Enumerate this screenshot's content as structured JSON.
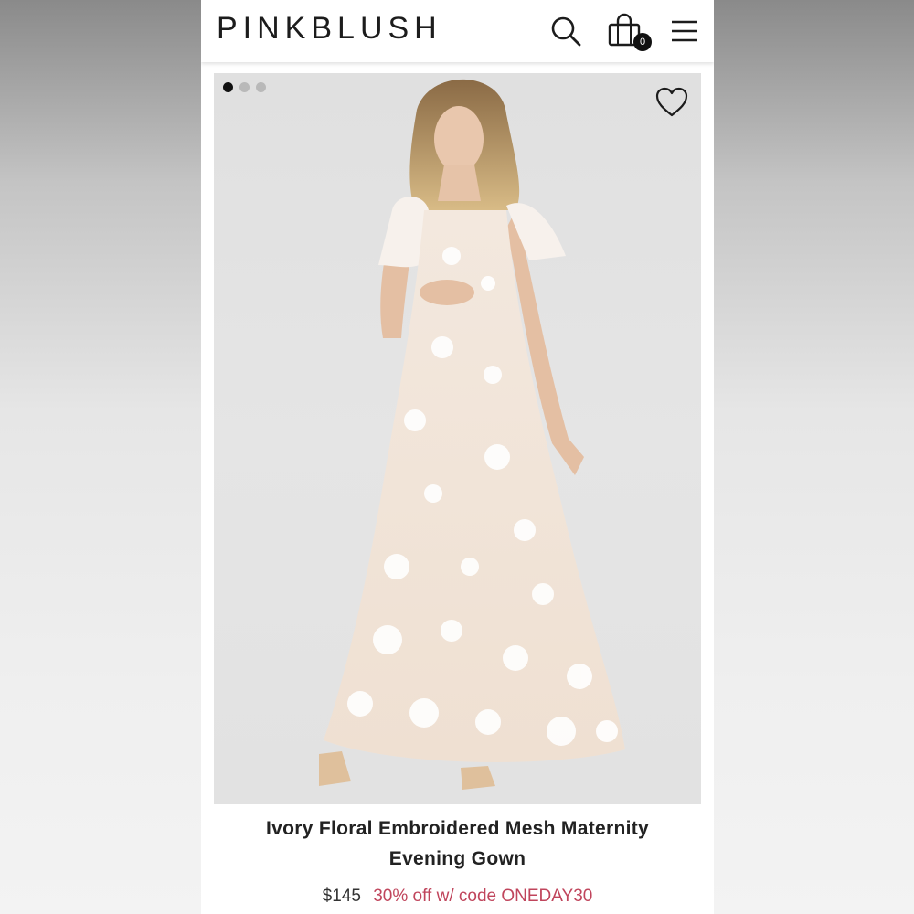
{
  "header": {
    "logo": "PINKBLUSH",
    "cart_count": "0",
    "icons": [
      "search-icon",
      "shopping-bag-icon",
      "menu-icon"
    ]
  },
  "gallery": {
    "image_count": 3,
    "active_index": 0
  },
  "product": {
    "title_line1": "Ivory Floral Embroidered Mesh Maternity",
    "title_line2": "Evening Gown",
    "price": "$145",
    "promo": "30% off w/ code ONEDAY30"
  },
  "colors": {
    "promo": "#c0455c",
    "text": "#222222",
    "dot_active": "#111111",
    "dot_inactive": "#b9b9b9"
  }
}
